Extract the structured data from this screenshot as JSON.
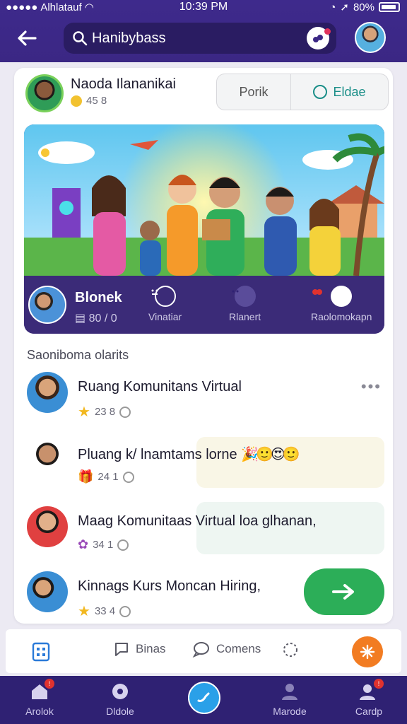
{
  "status": {
    "carrier": "Alhlatauf",
    "time": "10:39 PM",
    "battery": "80%"
  },
  "search": {
    "query": "Hanibybass"
  },
  "profile": {
    "name": "Naoda Ilananikai",
    "score": "45 8"
  },
  "segment": {
    "left": "Porik",
    "right": "Eldae"
  },
  "banner": {
    "title": "Blonek",
    "subtitle": "80 / 0",
    "actions": [
      {
        "label": "Vinatiar"
      },
      {
        "label": "Rlanert"
      },
      {
        "label": "Raolomokapn"
      }
    ]
  },
  "section_title": "Saoniboma olarits",
  "rows": [
    {
      "name": "Ruang Komunitans Virtual",
      "meta": "23 8"
    },
    {
      "name": "Pluang k/ lnamtams lorne",
      "meta": "24 1"
    },
    {
      "name": "Maag Komunitaas Virtual loa glhanan,",
      "meta": "34 1"
    },
    {
      "name": "Kinnags Kurs Moncan Hiring,",
      "meta": "33 4"
    }
  ],
  "toolbar": {
    "chat": "Binas",
    "comments": "Comens"
  },
  "nav": [
    {
      "label": "Arolok"
    },
    {
      "label": "Dldole"
    },
    {
      "label": "Marode"
    },
    {
      "label": "Cardp"
    }
  ],
  "colors": {
    "primary": "#3e2a8c",
    "accent_green": "#2cae58",
    "accent_orange": "#f27c22"
  }
}
